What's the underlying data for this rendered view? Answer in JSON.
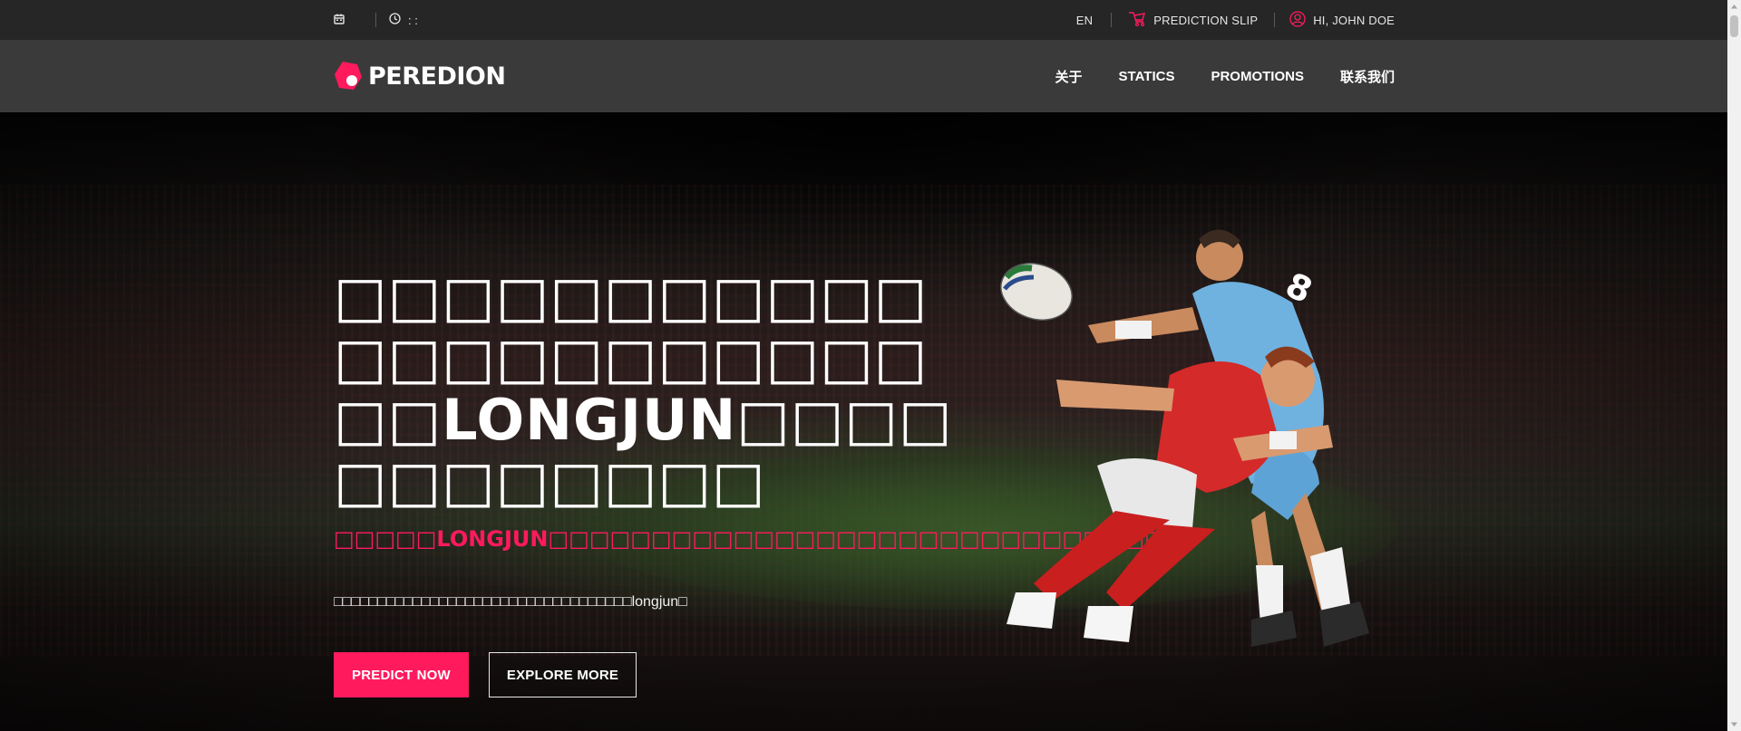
{
  "topbar": {
    "date_text": "",
    "time_text": ": :",
    "language": "EN",
    "prediction_slip": "PREDICTION SLIP",
    "user_greeting": "HI, JOHN DOE"
  },
  "nav": {
    "logo_text": "PEREDION",
    "menu": [
      {
        "label": "关于"
      },
      {
        "label": "STATICS"
      },
      {
        "label": "PROMOTIONS"
      },
      {
        "label": "联系我们"
      }
    ]
  },
  "hero": {
    "title": "□□□□□□□□□□□□□□□□□□□□□□□□LONGJUN□□□□□□□□□□□□",
    "subtitle": "□□□□□LONGJUN□□□□□□□□□□□□□□□□□□□□□□□□□□□□□□",
    "description": "□□□□□□□□□□□□□□□□□□□□□□□□□□□□□□□□□□longjun□",
    "buttons": {
      "primary": "PREDICT NOW",
      "secondary": "EXPLORE MORE"
    }
  },
  "colors": {
    "accent": "#ff1a5e",
    "topbar_bg": "#262626",
    "nav_bg": "#3a3a3a"
  },
  "icons": {
    "calendar": "calendar-icon",
    "clock": "clock-icon",
    "slip": "ticket-icon",
    "user": "user-circle-icon"
  }
}
